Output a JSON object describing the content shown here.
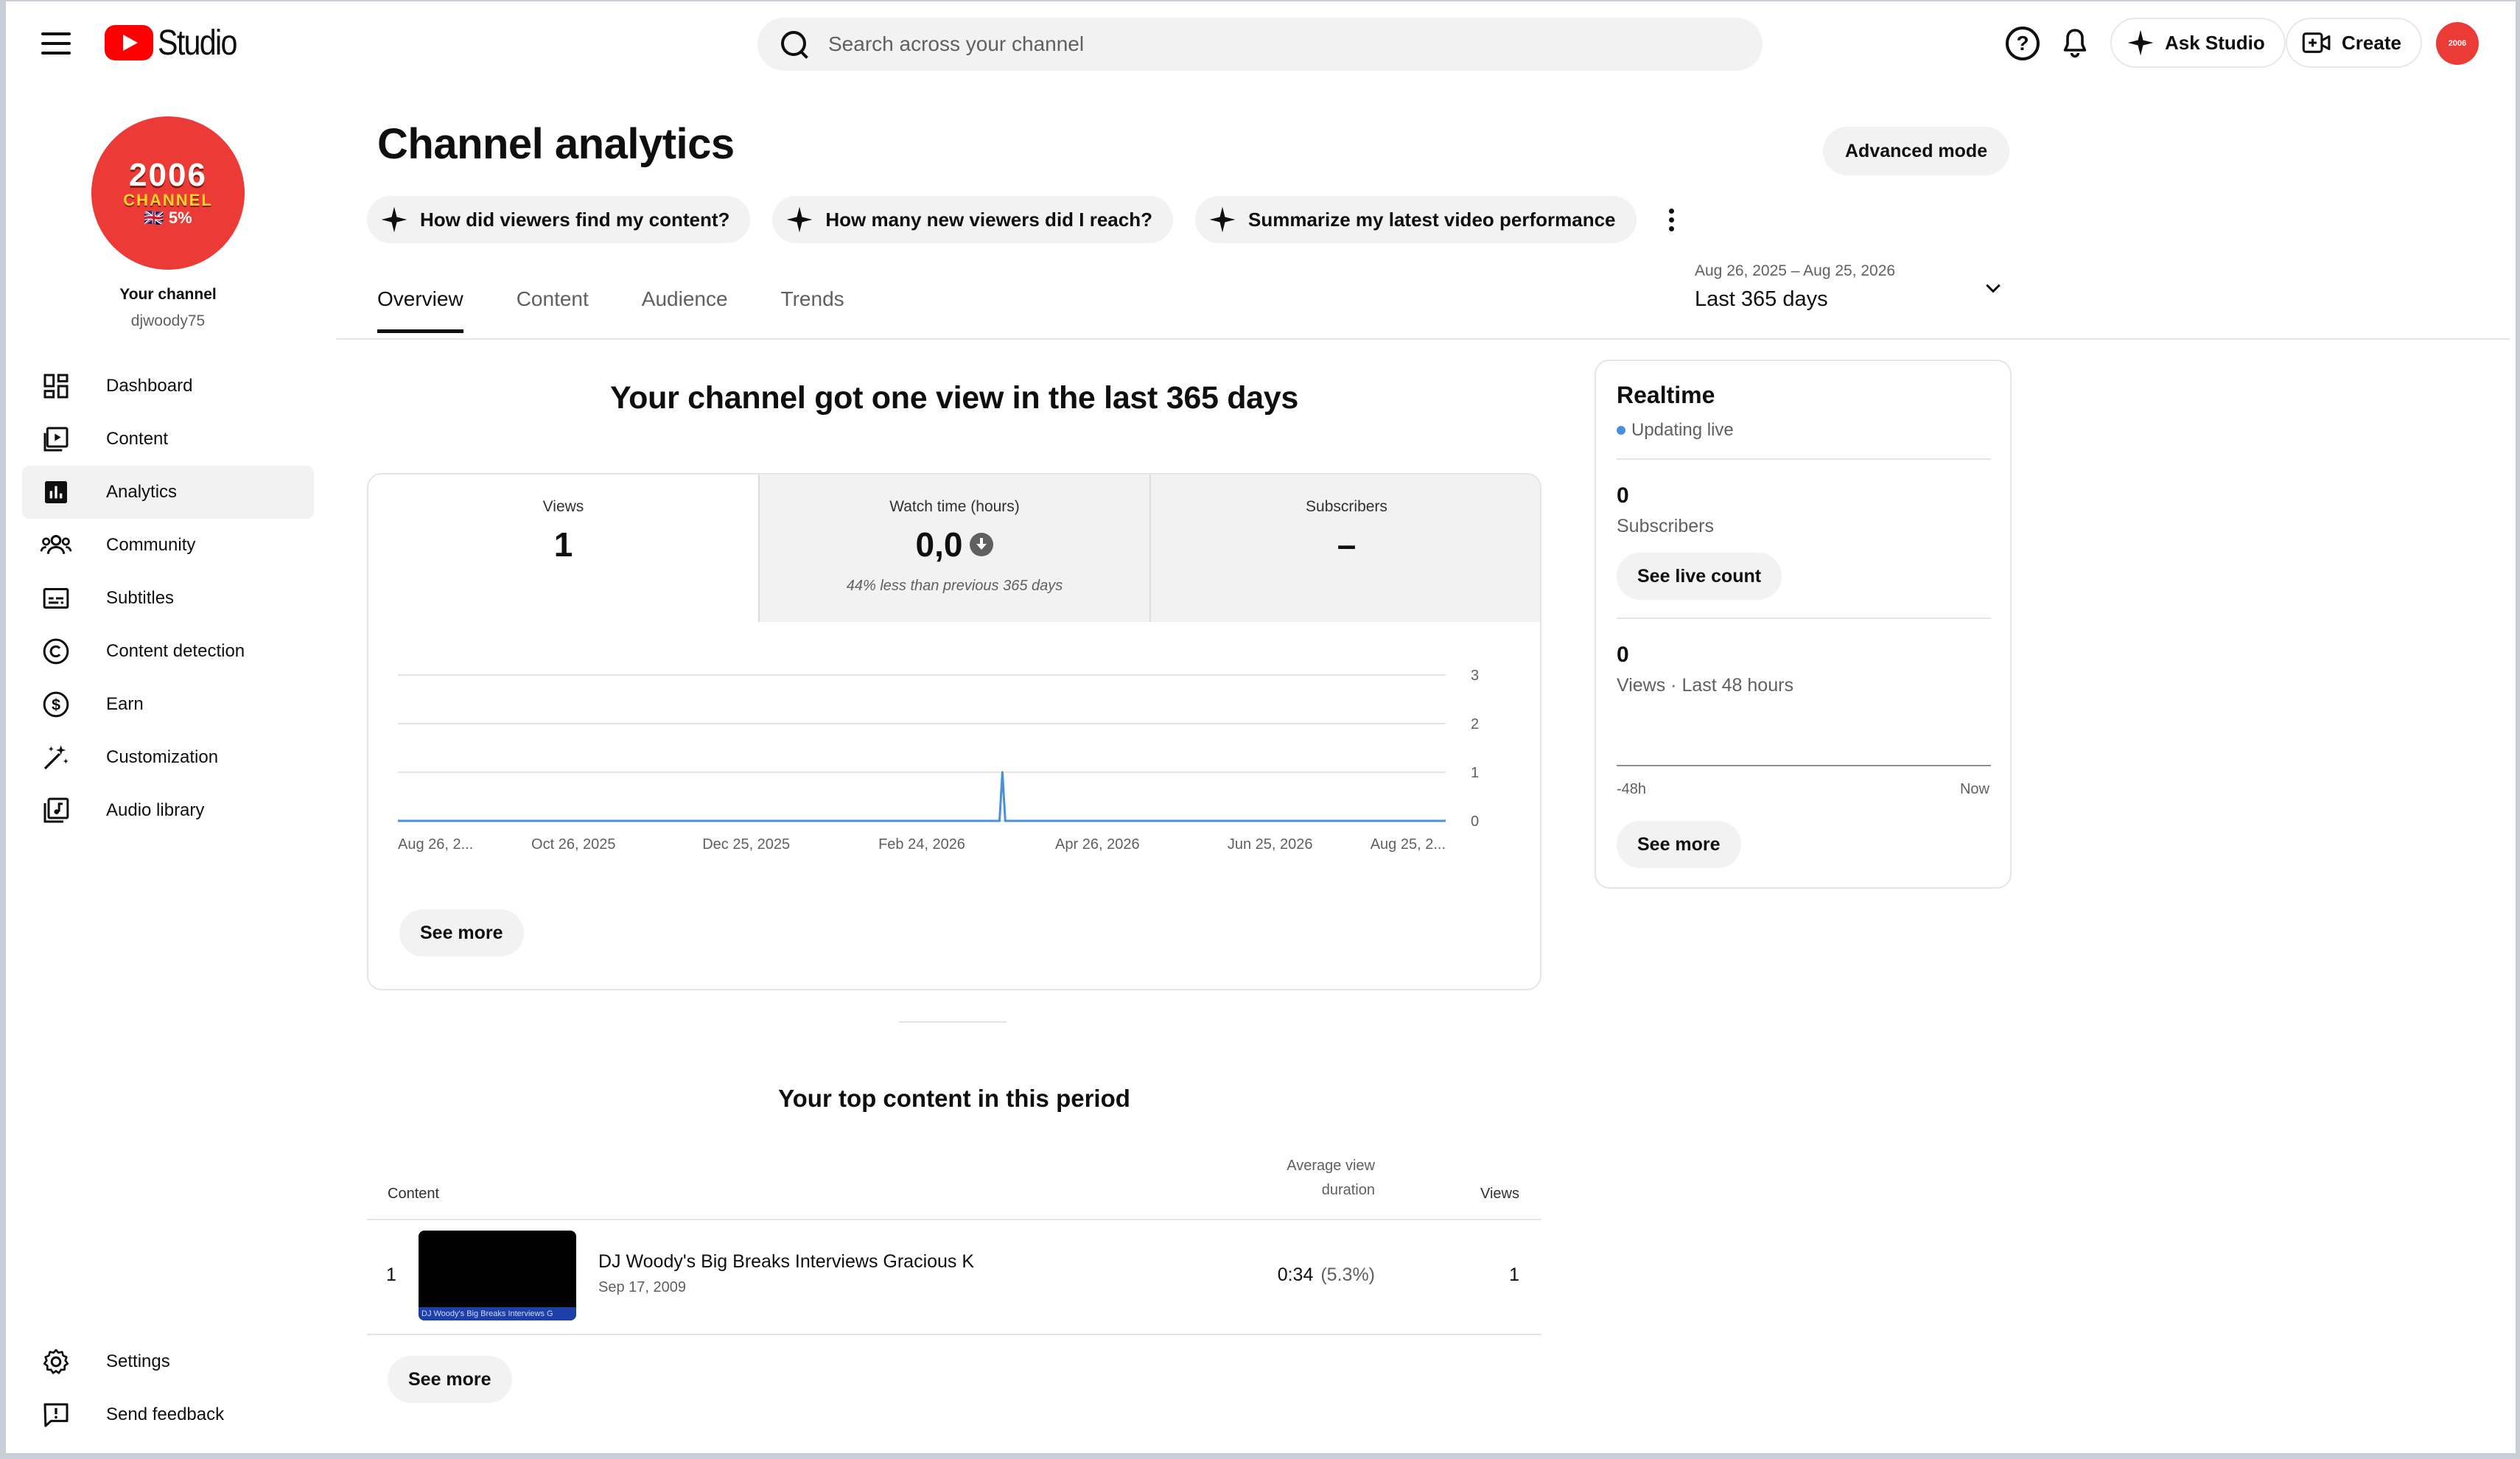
{
  "app": {
    "logo_text": "Studio",
    "search_placeholder": "Search across your channel",
    "ask_studio_label": "Ask Studio",
    "create_label": "Create",
    "avatar_small_text": "2006"
  },
  "sidebar": {
    "avatar_line1": "2006",
    "avatar_line2": "CHANNEL",
    "avatar_line3": "🇬🇧 5%",
    "channel_label": "Your channel",
    "handle": "djwoody75",
    "items": [
      {
        "label": "Dashboard",
        "icon": "dashboard-icon"
      },
      {
        "label": "Content",
        "icon": "content-icon"
      },
      {
        "label": "Analytics",
        "icon": "analytics-icon",
        "active": true
      },
      {
        "label": "Community",
        "icon": "community-icon"
      },
      {
        "label": "Subtitles",
        "icon": "subtitles-icon"
      },
      {
        "label": "Content detection",
        "icon": "copyright-icon"
      },
      {
        "label": "Earn",
        "icon": "dollar-icon"
      },
      {
        "label": "Customization",
        "icon": "magic-wand-icon"
      },
      {
        "label": "Audio library",
        "icon": "audio-library-icon"
      }
    ],
    "bottom_items": [
      {
        "label": "Settings",
        "icon": "gear-icon"
      },
      {
        "label": "Send feedback",
        "icon": "feedback-icon"
      }
    ]
  },
  "main": {
    "title": "Channel analytics",
    "advanced_mode_label": "Advanced mode",
    "chips": [
      "How did viewers find my content?",
      "How many new viewers did I reach?",
      "Summarize my latest video performance"
    ],
    "tabs": [
      {
        "label": "Overview",
        "active": true
      },
      {
        "label": "Content"
      },
      {
        "label": "Audience"
      },
      {
        "label": "Trends"
      }
    ],
    "date_range": {
      "range": "Aug 26, 2025 – Aug 25, 2026",
      "label": "Last 365 days"
    },
    "headline": "Your channel got one view in the last 365 days",
    "metrics": [
      {
        "label": "Views",
        "value": "1",
        "selected": true
      },
      {
        "label": "Watch time (hours)",
        "value": "0,0",
        "note": "44% less than previous 365 days"
      },
      {
        "label": "Subscribers",
        "value": "–"
      }
    ],
    "chart_see_more": "See more",
    "top_content": {
      "title": "Your top content in this period",
      "col_content": "Content",
      "col_avd_1": "Average view",
      "col_avd_2": "duration",
      "col_views": "Views",
      "rows": [
        {
          "rank": "1",
          "title": "DJ Woody's Big Breaks Interviews Gracious K",
          "date": "Sep 17, 2009",
          "thumb_caption": "DJ Woody's Big Breaks Interviews G",
          "duration": "0:34",
          "pct": "(5.3%)",
          "views": "1"
        }
      ],
      "see_more": "See more"
    }
  },
  "realtime": {
    "title": "Realtime",
    "live_label": "Updating live",
    "subscribers_value": "0",
    "subscribers_label": "Subscribers",
    "see_live_count": "See live count",
    "views_value": "0",
    "views_label": "Views · Last 48 hours",
    "axis_start": "-48h",
    "axis_end": "Now",
    "see_more": "See more"
  },
  "colors": {
    "accent_line": "#4a90d9",
    "brand_red": "#ff0000",
    "avatar_red": "#ec3a36"
  },
  "chart_data": {
    "type": "line",
    "title": "",
    "xlabel": "",
    "ylabel": "",
    "ylim": [
      0,
      3
    ],
    "y_ticks": [
      "0",
      "1",
      "2",
      "3"
    ],
    "x_tick_labels": [
      "Aug 26, 2...",
      "Oct 26, 2025",
      "Dec 25, 2025",
      "Feb 24, 2026",
      "Apr 26, 2026",
      "Jun 25, 2026",
      "Aug 25, 2..."
    ],
    "x_tick_dates": [
      "2025-08-26",
      "2025-10-26",
      "2025-12-25",
      "2026-02-24",
      "2026-04-26",
      "2026-06-25",
      "2026-08-25"
    ],
    "series": [
      {
        "points": [
          {
            "x": "2025-08-26",
            "y": 0
          },
          {
            "x": "2026-03-23",
            "y": 0
          },
          {
            "x": "2026-03-24",
            "y": 1
          },
          {
            "x": "2026-03-25",
            "y": 0
          },
          {
            "x": "2026-08-25",
            "y": 0
          }
        ]
      }
    ]
  }
}
